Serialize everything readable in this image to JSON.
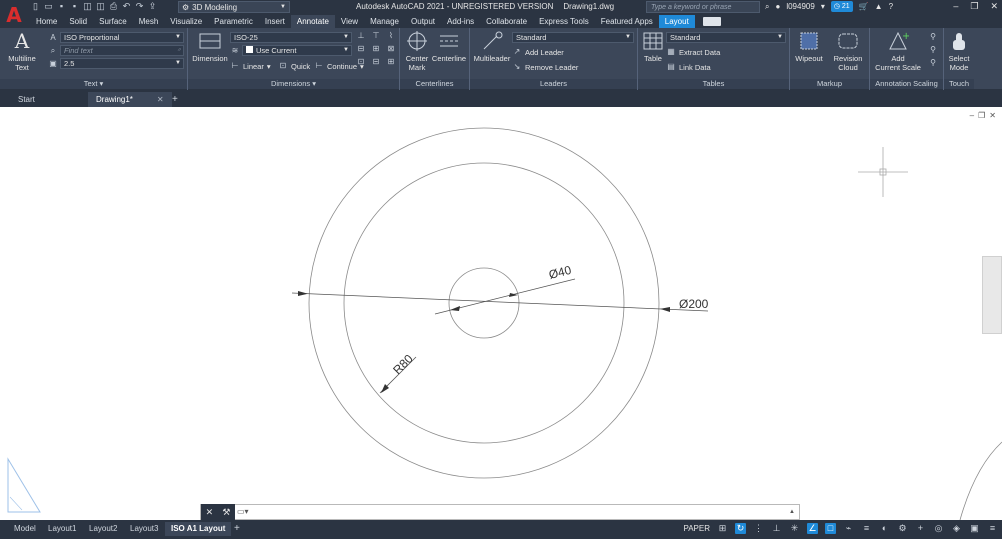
{
  "app": {
    "title": "Autodesk AutoCAD 2021 - UNREGISTERED VERSION",
    "document": "Drawing1.dwg",
    "logo": "A",
    "workspace": "3D Modeling",
    "search_placeholder": "Type a keyword or phrase",
    "user": "l094909",
    "notifications": "21",
    "accent_color": "#1f8ad8"
  },
  "ribbon_tabs": [
    "Home",
    "Solid",
    "Surface",
    "Mesh",
    "Visualize",
    "Parametric",
    "Insert",
    "Annotate",
    "View",
    "Manage",
    "Output",
    "Add-ins",
    "Collaborate",
    "Express Tools",
    "Featured Apps",
    "Layout"
  ],
  "ribbon": {
    "text_panel": {
      "label": "Text",
      "big_button": [
        "Multiline",
        "Text"
      ],
      "style": "ISO Proportional",
      "find_placeholder": "Find text",
      "height": "2.5"
    },
    "dimensions_panel": {
      "label": "Dimensions",
      "big_button": "Dimension",
      "style": "ISO-25",
      "layer": "Use Current",
      "linear": "Linear",
      "quick": "Quick",
      "continue": "Continue"
    },
    "centerlines_panel": {
      "label": "Centerlines",
      "center_mark": [
        "Center",
        "Mark"
      ],
      "centerline": "Centerline"
    },
    "leaders_panel": {
      "label": "Leaders",
      "big_button": "Multileader",
      "style": "Standard",
      "add_leader": "Add Leader",
      "remove_leader": "Remove Leader"
    },
    "tables_panel": {
      "label": "Tables",
      "big_button": "Table",
      "style": "Standard",
      "extract_data": "Extract Data",
      "link_data": "Link Data"
    },
    "markup_panel": {
      "label": "Markup",
      "wipeout": "Wipeout",
      "revision_cloud": [
        "Revision",
        "Cloud"
      ]
    },
    "annotation_scaling_panel": {
      "label": "Annotation Scaling",
      "add_current_scale": [
        "Add",
        "Current Scale"
      ]
    },
    "touch_panel": {
      "label": "Touch",
      "select_mode": [
        "Select",
        "Mode"
      ]
    }
  },
  "file_tabs": [
    {
      "label": "Start"
    },
    {
      "label": "Drawing1*"
    }
  ],
  "drawing": {
    "dim_diameter_inner": "Ø40",
    "dim_diameter_outer": "Ø200",
    "dim_radius": "R80"
  },
  "layout_tabs": [
    "Model",
    "Layout1",
    "Layout2",
    "Layout3",
    "ISO A1 Layout"
  ],
  "status": {
    "space": "PAPER"
  }
}
